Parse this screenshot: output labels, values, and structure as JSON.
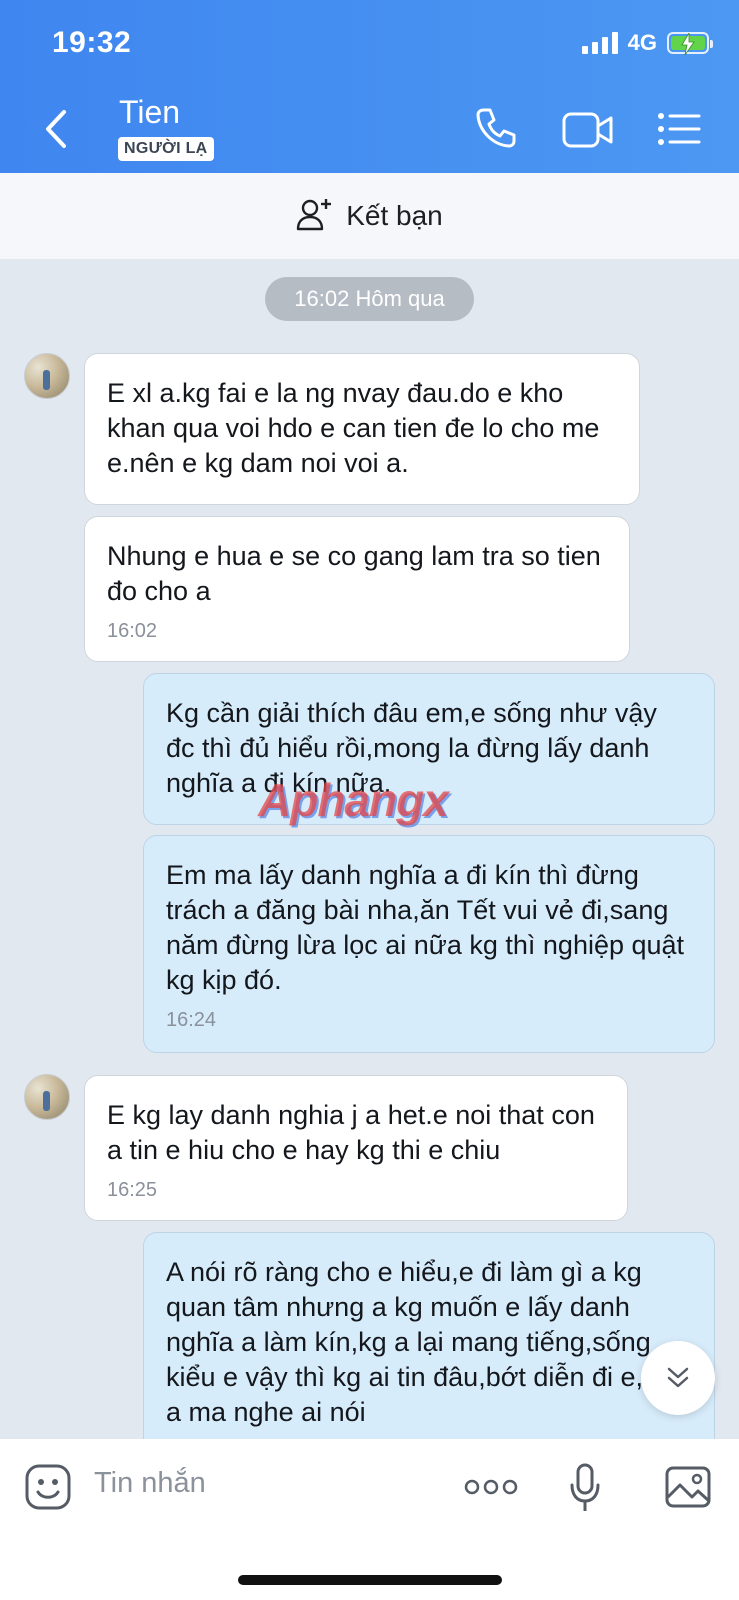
{
  "status_bar": {
    "time": "19:32",
    "network": "4G"
  },
  "header": {
    "contact_name": "Tien",
    "badge": "NGƯỜI LẠ",
    "icons": [
      "back-icon",
      "phone-icon",
      "video-call-icon",
      "menu-list-icon"
    ]
  },
  "friend_bar": {
    "label": "Kết bạn",
    "icon": "add-friend-icon"
  },
  "date_separator": "16:02 Hôm qua",
  "messages": [
    {
      "side": "in",
      "text": "E xl a.kg fai e la ng nvay đau.do e kho khan qua voi hdo e can tien đe lo cho me e.nên e kg dam noi voi a.",
      "time": ""
    },
    {
      "side": "in",
      "text": "Nhung e hua e se co gang lam tra so tien đo cho a",
      "time": "16:02"
    },
    {
      "side": "out",
      "text": "Kg cần giải thích đâu em,e sống như vậy đc thì đủ hiểu rồi,mong la đừng lấy danh nghĩa a đi kín nữa.",
      "time": ""
    },
    {
      "side": "out",
      "text": "Em ma lấy danh nghĩa a đi kín thì đừng trách a đăng bài nha,ăn Tết vui vẻ đi,sang năm đừng lừa lọc ai nữa kg thì nghiệp quật kg kịp đó.",
      "time": "16:24"
    },
    {
      "side": "in",
      "text": "E kg lay danh nghia j a het.e noi that con a tin e hiu cho e hay kg thi e chiu",
      "time": "16:25"
    },
    {
      "side": "out",
      "text": "A nói rõ ràng cho e hiểu,e đi làm gì a kg quan tâm nhưng a kg muốn e lấy danh nghĩa a làm kín,kg a lại mang tiếng,sống kiểu e vậy thì kg ai tin đâu,bớt diễn đi e,con a ma nghe ai nói",
      "time": ""
    }
  ],
  "watermark": "Aphangx",
  "input": {
    "placeholder": "Tin nhắn"
  },
  "colors": {
    "header": "#4290f1",
    "bubble_in": "#ffffff",
    "bubble_out": "#d7ecfb",
    "chat_bg": "#e2e8f0"
  }
}
